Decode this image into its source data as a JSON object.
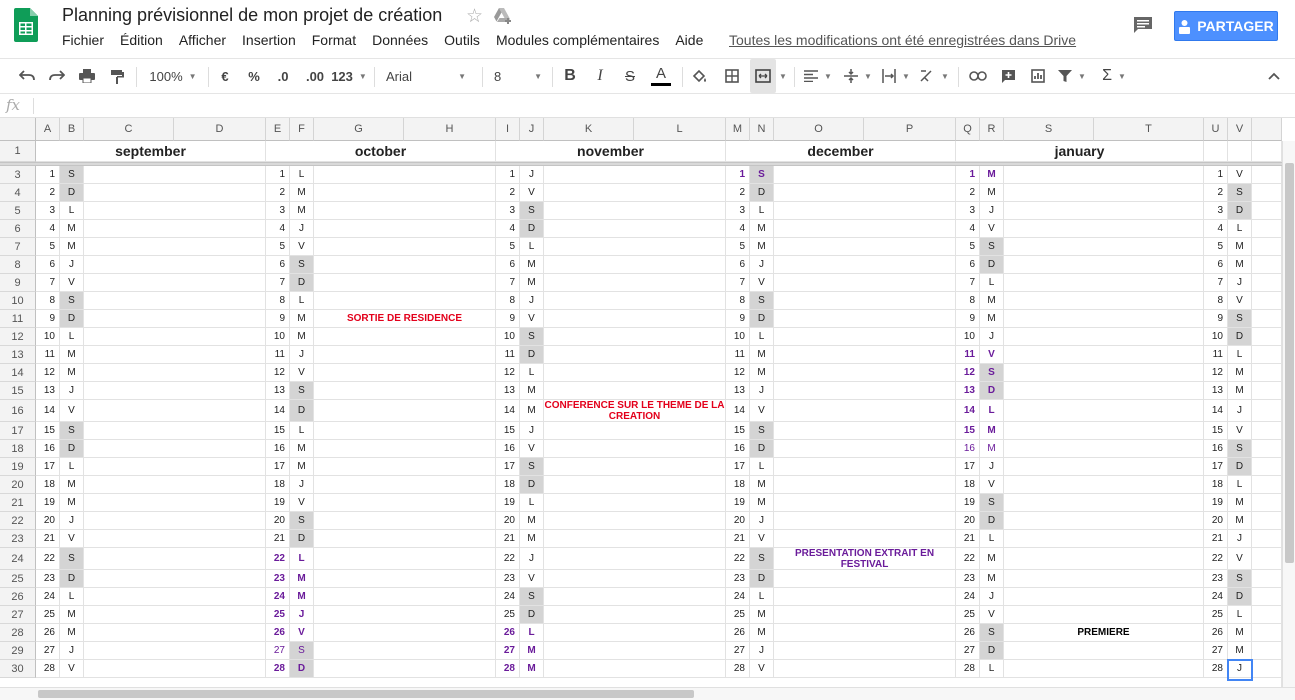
{
  "app": {
    "title": "Planning prévisionnel de mon projet de création",
    "menu": [
      "Fichier",
      "Édition",
      "Afficher",
      "Insertion",
      "Format",
      "Données",
      "Outils",
      "Modules complémentaires",
      "Aide"
    ],
    "save_status": "Toutes les modifications ont été enregistrées dans Drive",
    "share_label": "PARTAGER"
  },
  "toolbar": {
    "zoom": "100%",
    "currency": "€",
    "percent": "%",
    "dec_less": ".0",
    "dec_more": ".00",
    "format_more": "123",
    "font": "Arial",
    "font_size": "8"
  },
  "formula_bar": {
    "fx": "fx",
    "value": ""
  },
  "columns": [
    "A",
    "B",
    "C",
    "D",
    "E",
    "F",
    "G",
    "H",
    "I",
    "J",
    "K",
    "L",
    "M",
    "N",
    "O",
    "P",
    "Q",
    "R",
    "S",
    "T",
    "U",
    "V"
  ],
  "months": [
    "september",
    "october",
    "november",
    "december",
    "january"
  ],
  "row_numbers": [
    1,
    3,
    4,
    5,
    6,
    7,
    8,
    9,
    10,
    11,
    12,
    13,
    14,
    15,
    16,
    17,
    18,
    19,
    20,
    21,
    22,
    23,
    24,
    25,
    26,
    27,
    28,
    29,
    30
  ],
  "calendar": {
    "september": [
      [
        "1",
        "S"
      ],
      [
        "2",
        "D"
      ],
      [
        "3",
        "L"
      ],
      [
        "4",
        "M"
      ],
      [
        "5",
        "M"
      ],
      [
        "6",
        "J"
      ],
      [
        "7",
        "V"
      ],
      [
        "8",
        "S"
      ],
      [
        "9",
        "D"
      ],
      [
        "10",
        "L"
      ],
      [
        "11",
        "M"
      ],
      [
        "12",
        "M"
      ],
      [
        "13",
        "J"
      ],
      [
        "14",
        "V"
      ],
      [
        "15",
        "S"
      ],
      [
        "16",
        "D"
      ],
      [
        "17",
        "L"
      ],
      [
        "18",
        "M"
      ],
      [
        "19",
        "M"
      ],
      [
        "20",
        "J"
      ],
      [
        "21",
        "V"
      ],
      [
        "22",
        "S"
      ],
      [
        "23",
        "D"
      ],
      [
        "24",
        "L"
      ],
      [
        "25",
        "M"
      ],
      [
        "26",
        "M"
      ],
      [
        "27",
        "J"
      ],
      [
        "28",
        "V"
      ]
    ],
    "october": [
      [
        "1",
        "L"
      ],
      [
        "2",
        "M"
      ],
      [
        "3",
        "M"
      ],
      [
        "4",
        "J"
      ],
      [
        "5",
        "V"
      ],
      [
        "6",
        "S"
      ],
      [
        "7",
        "D"
      ],
      [
        "8",
        "L"
      ],
      [
        "9",
        "M"
      ],
      [
        "10",
        "M"
      ],
      [
        "11",
        "J"
      ],
      [
        "12",
        "V"
      ],
      [
        "13",
        "S"
      ],
      [
        "14",
        "D"
      ],
      [
        "15",
        "L"
      ],
      [
        "16",
        "M"
      ],
      [
        "17",
        "M"
      ],
      [
        "18",
        "J"
      ],
      [
        "19",
        "V"
      ],
      [
        "20",
        "S"
      ],
      [
        "21",
        "D"
      ],
      [
        "22",
        "L"
      ],
      [
        "23",
        "M"
      ],
      [
        "24",
        "M"
      ],
      [
        "25",
        "J"
      ],
      [
        "26",
        "V"
      ],
      [
        "27",
        "S"
      ],
      [
        "28",
        "D"
      ]
    ],
    "november": [
      [
        "1",
        "J"
      ],
      [
        "2",
        "V"
      ],
      [
        "3",
        "S"
      ],
      [
        "4",
        "D"
      ],
      [
        "5",
        "L"
      ],
      [
        "6",
        "M"
      ],
      [
        "7",
        "M"
      ],
      [
        "8",
        "J"
      ],
      [
        "9",
        "V"
      ],
      [
        "10",
        "S"
      ],
      [
        "11",
        "D"
      ],
      [
        "12",
        "L"
      ],
      [
        "13",
        "M"
      ],
      [
        "14",
        "M"
      ],
      [
        "15",
        "J"
      ],
      [
        "16",
        "V"
      ],
      [
        "17",
        "S"
      ],
      [
        "18",
        "D"
      ],
      [
        "19",
        "L"
      ],
      [
        "20",
        "M"
      ],
      [
        "21",
        "M"
      ],
      [
        "22",
        "J"
      ],
      [
        "23",
        "V"
      ],
      [
        "24",
        "S"
      ],
      [
        "25",
        "D"
      ],
      [
        "26",
        "L"
      ],
      [
        "27",
        "M"
      ],
      [
        "28",
        "M"
      ]
    ],
    "december": [
      [
        "1",
        "S"
      ],
      [
        "2",
        "D"
      ],
      [
        "3",
        "L"
      ],
      [
        "4",
        "M"
      ],
      [
        "5",
        "M"
      ],
      [
        "6",
        "J"
      ],
      [
        "7",
        "V"
      ],
      [
        "8",
        "S"
      ],
      [
        "9",
        "D"
      ],
      [
        "10",
        "L"
      ],
      [
        "11",
        "M"
      ],
      [
        "12",
        "M"
      ],
      [
        "13",
        "J"
      ],
      [
        "14",
        "V"
      ],
      [
        "15",
        "S"
      ],
      [
        "16",
        "D"
      ],
      [
        "17",
        "L"
      ],
      [
        "18",
        "M"
      ],
      [
        "19",
        "M"
      ],
      [
        "20",
        "J"
      ],
      [
        "21",
        "V"
      ],
      [
        "22",
        "S"
      ],
      [
        "23",
        "D"
      ],
      [
        "24",
        "L"
      ],
      [
        "25",
        "M"
      ],
      [
        "26",
        "M"
      ],
      [
        "27",
        "J"
      ],
      [
        "28",
        "V"
      ]
    ],
    "january": [
      [
        "1",
        "M"
      ],
      [
        "2",
        "M"
      ],
      [
        "3",
        "J"
      ],
      [
        "4",
        "V"
      ],
      [
        "5",
        "S"
      ],
      [
        "6",
        "D"
      ],
      [
        "7",
        "L"
      ],
      [
        "8",
        "M"
      ],
      [
        "9",
        "M"
      ],
      [
        "10",
        "J"
      ],
      [
        "11",
        "V"
      ],
      [
        "12",
        "S"
      ],
      [
        "13",
        "D"
      ],
      [
        "14",
        "L"
      ],
      [
        "15",
        "M"
      ],
      [
        "16",
        "M"
      ],
      [
        "17",
        "J"
      ],
      [
        "18",
        "V"
      ],
      [
        "19",
        "S"
      ],
      [
        "20",
        "D"
      ],
      [
        "21",
        "L"
      ],
      [
        "22",
        "M"
      ],
      [
        "23",
        "M"
      ],
      [
        "24",
        "J"
      ],
      [
        "25",
        "V"
      ],
      [
        "26",
        "S"
      ],
      [
        "27",
        "D"
      ],
      [
        "28",
        "L"
      ]
    ],
    "february": [
      [
        "1",
        "V"
      ],
      [
        "2",
        "S"
      ],
      [
        "3",
        "D"
      ],
      [
        "4",
        "L"
      ],
      [
        "5",
        "M"
      ],
      [
        "6",
        "M"
      ],
      [
        "7",
        "J"
      ],
      [
        "8",
        "V"
      ],
      [
        "9",
        "S"
      ],
      [
        "10",
        "D"
      ],
      [
        "11",
        "L"
      ],
      [
        "12",
        "M"
      ],
      [
        "13",
        "M"
      ],
      [
        "14",
        "J"
      ],
      [
        "15",
        "V"
      ],
      [
        "16",
        "S"
      ],
      [
        "17",
        "D"
      ],
      [
        "18",
        "L"
      ],
      [
        "19",
        "M"
      ],
      [
        "20",
        "M"
      ],
      [
        "21",
        "J"
      ],
      [
        "22",
        "V"
      ],
      [
        "23",
        "S"
      ],
      [
        "24",
        "D"
      ],
      [
        "25",
        "L"
      ],
      [
        "26",
        "M"
      ],
      [
        "27",
        "M"
      ],
      [
        "28",
        "J"
      ]
    ]
  },
  "events": [
    {
      "text": "SORTIE DE RESIDENCE",
      "color": "#e3001b"
    },
    {
      "text": "CONFERENCE SUR LE THEME DE LA CREATION",
      "color": "#e3001b"
    },
    {
      "text": "PRESENTATION EXTRAIT EN FESTIVAL",
      "color": "#6a1b9a"
    },
    {
      "text": "PREMIERE",
      "color": "#000000"
    }
  ],
  "colors": {
    "accent": "#4d90fe",
    "weekend": "#d4d4d4",
    "highlight": "#6a1b9a",
    "event_red": "#e3001b",
    "logo_green": "#0f9d58"
  }
}
